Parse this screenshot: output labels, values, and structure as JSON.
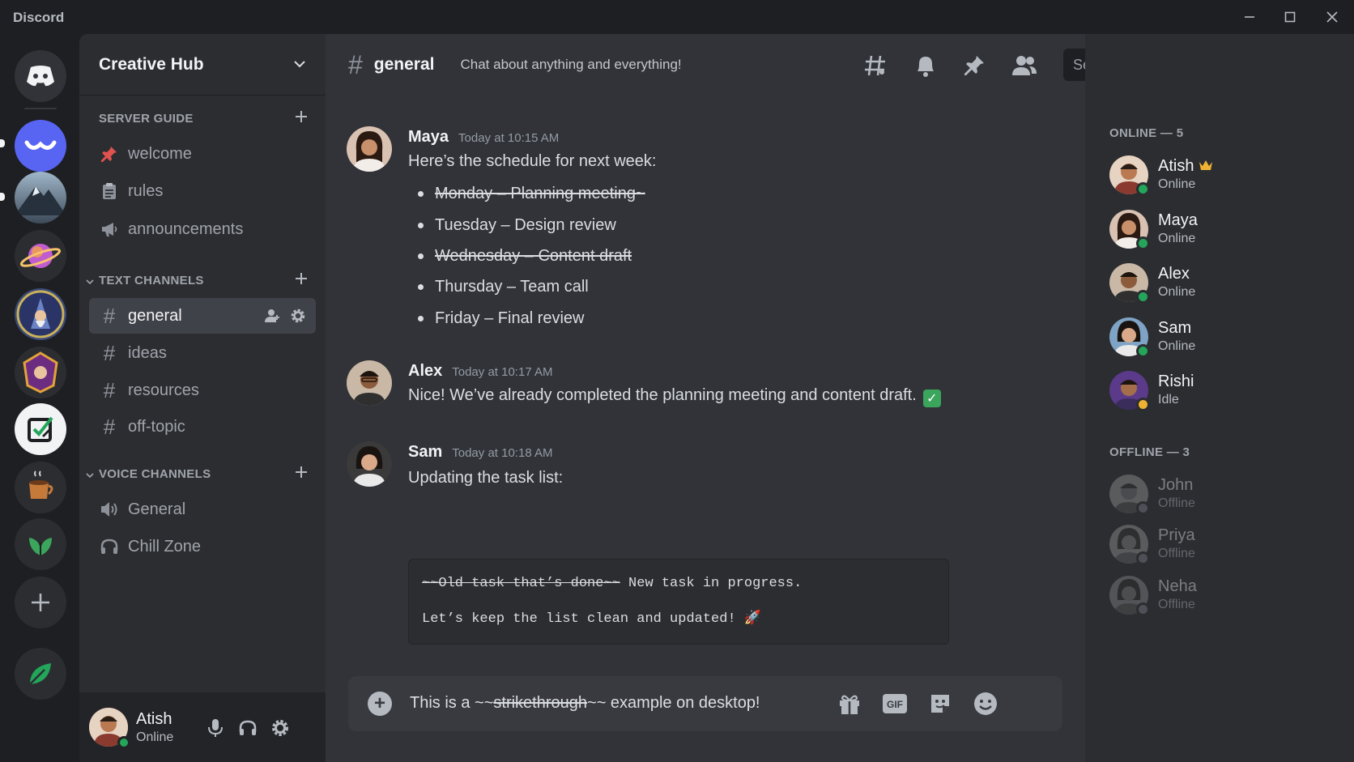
{
  "app": {
    "title": "Discord"
  },
  "colors": {
    "online": "#23a55a",
    "idle": "#f0b232",
    "offline": "#80848e",
    "accent": "#5865f2",
    "active_channel_bg": "#404249"
  },
  "server": {
    "name": "Creative Hub"
  },
  "categories": {
    "server_guide": "SERVER GUIDE",
    "text_channels": "TEXT CHANNELS",
    "voice_channels": "VOICE CHANNELS"
  },
  "guide_channels": [
    {
      "name": "welcome",
      "icon": "pin-icon"
    },
    {
      "name": "rules",
      "icon": "clipboard-icon"
    },
    {
      "name": "announcements",
      "icon": "megaphone-icon"
    }
  ],
  "text_channels": [
    "general",
    "ideas",
    "resources",
    "off-topic"
  ],
  "voice_channels": [
    {
      "name": "General",
      "icon": "speaker-icon"
    },
    {
      "name": "Chill Zone",
      "icon": "headphones-icon"
    }
  ],
  "user": {
    "name": "Atish",
    "status": "Online"
  },
  "channel": {
    "name": "general",
    "topic": "Chat about anything and everything!"
  },
  "search": {
    "placeholder": "Search"
  },
  "messages": [
    {
      "author": "Maya",
      "time": "Today at 10:15 AM",
      "text": "Here’s the schedule for next week:",
      "bullets": [
        {
          "text": "Monday – Planning meeting~",
          "strike": true
        },
        {
          "text": "Tuesday – Design review",
          "strike": false
        },
        {
          "text": "Wednesday – Content draft",
          "strike": true
        },
        {
          "text": "Thursday – Team call",
          "strike": false
        },
        {
          "text": "Friday – Final review",
          "strike": false
        }
      ]
    },
    {
      "author": "Alex",
      "time": "Today at 10:17 AM",
      "text": "Nice! We’ve already completed the planning meeting and content draft.",
      "emoji": "✓"
    },
    {
      "author": "Sam",
      "time": "Today at 10:18 AM",
      "text": "Updating the task list:",
      "code": {
        "line1_strike": "~~Old task that’s done~~",
        "line1_rest": " New task in progress.",
        "line2": "Let’s keep the list clean and updated! 🚀"
      }
    }
  ],
  "composer": {
    "before": "This is a ~~",
    "strike": "strikethrough",
    "after": "~~ example on desktop!"
  },
  "members": {
    "online_label": "ONLINE — 5",
    "offline_label": "OFFLINE — 3",
    "online": [
      {
        "name": "Atish",
        "status": "Online",
        "crown": true
      },
      {
        "name": "Maya",
        "status": "Online"
      },
      {
        "name": "Alex",
        "status": "Online"
      },
      {
        "name": "Sam",
        "status": "Online"
      },
      {
        "name": "Rishi",
        "status": "Idle"
      }
    ],
    "offline": [
      {
        "name": "John",
        "status": "Offline"
      },
      {
        "name": "Priya",
        "status": "Offline"
      },
      {
        "name": "Neha",
        "status": "Offline"
      }
    ]
  }
}
